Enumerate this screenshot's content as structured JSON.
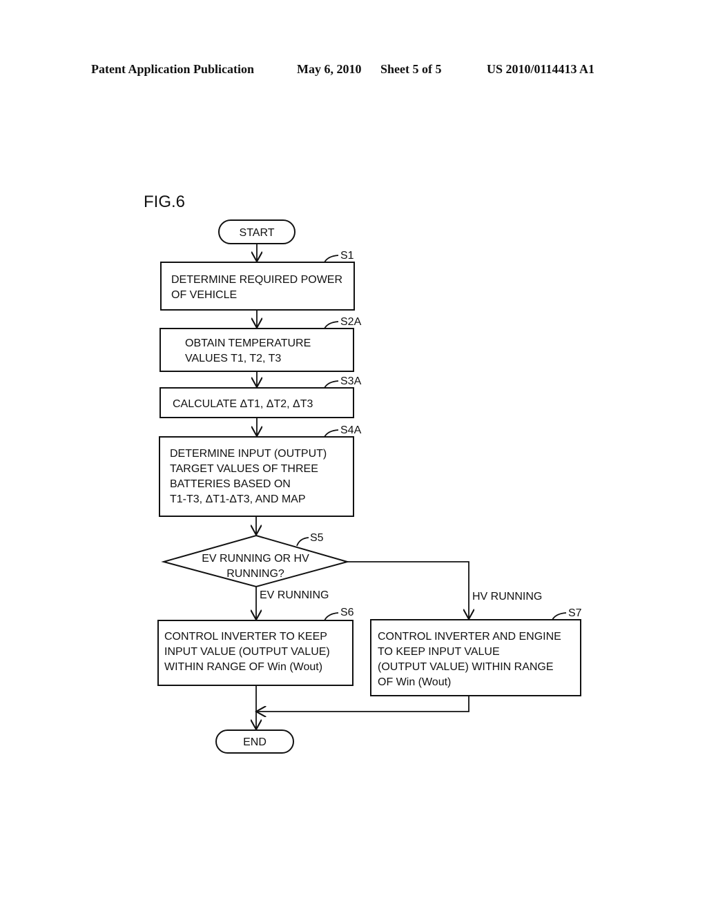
{
  "header": {
    "publication": "Patent Application Publication",
    "date": "May 6, 2010",
    "sheet": "Sheet 5 of 5",
    "number": "US 2010/0114413 A1"
  },
  "figure": {
    "title": "FIG.6",
    "start": "START",
    "end": "END",
    "steps": {
      "s1": {
        "id": "S1",
        "lines": [
          "DETERMINE REQUIRED POWER",
          "OF VEHICLE"
        ]
      },
      "s2a": {
        "id": "S2A",
        "lines": [
          "OBTAIN TEMPERATURE",
          "VALUES T1, T2, T3"
        ]
      },
      "s3a": {
        "id": "S3A",
        "lines": [
          "CALCULATE ΔT1, ΔT2, ΔT3"
        ]
      },
      "s4a": {
        "id": "S4A",
        "lines": [
          "DETERMINE INPUT (OUTPUT)",
          "TARGET VALUES OF THREE",
          "BATTERIES BASED ON",
          "T1-T3, ΔT1-ΔT3, AND MAP"
        ]
      },
      "s5": {
        "id": "S5",
        "lines": [
          "EV RUNNING OR HV",
          "RUNNING?"
        ]
      },
      "s6": {
        "id": "S6",
        "lines": [
          "CONTROL INVERTER TO KEEP",
          "INPUT VALUE (OUTPUT VALUE)",
          "WITHIN RANGE OF Win (Wout)"
        ]
      },
      "s7": {
        "id": "S7",
        "lines": [
          "CONTROL INVERTER AND ENGINE",
          "TO KEEP INPUT VALUE",
          "(OUTPUT VALUE) WITHIN RANGE",
          "OF Win (Wout)"
        ]
      }
    },
    "branches": {
      "ev": "EV RUNNING",
      "hv": "HV RUNNING"
    }
  }
}
